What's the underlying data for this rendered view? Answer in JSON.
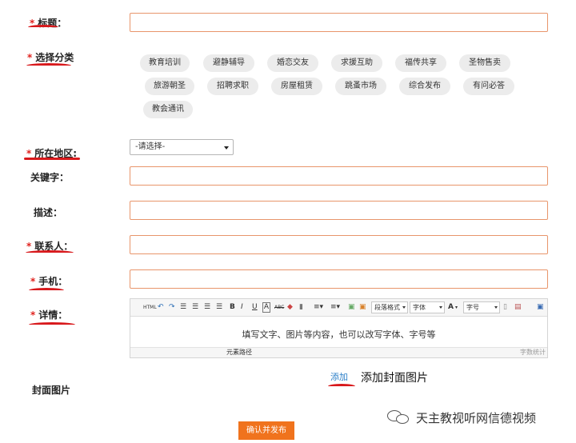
{
  "labels": {
    "required_mark": "*",
    "title": "标题：",
    "category": "选择分类",
    "region": "所在地区:",
    "keywords": "关键字：",
    "description": "描述：",
    "contact": "联系人：",
    "phone": "手机：",
    "details": "详情：",
    "cover": "封面图片"
  },
  "categories": [
    "教育培训",
    "避静辅导",
    "婚恋交友",
    "求援互助",
    "福传共享",
    "圣物售卖",
    "旅游朝圣",
    "招聘求职",
    "房屋租赁",
    "跳蚤市场",
    "综合发布",
    "有问必答",
    "教会通讯"
  ],
  "region_select": {
    "selected": "-请选择-"
  },
  "editor": {
    "toolbar": {
      "html": "HTML",
      "bold": "B",
      "italic": "I",
      "underline": "U",
      "font_color": "A",
      "strike": "ABC",
      "paragraph": "段落格式",
      "font": "字体",
      "font_size_icon": "A",
      "size": "字号"
    },
    "hint": "填写文字、图片等内容，也可以改写字体、字号等",
    "path_label": "元素路径",
    "count_label": "字数统计"
  },
  "cover": {
    "add_link": "添加",
    "add_note": "添加封面图片"
  },
  "submit_label": "确认并发布",
  "watermark": "天主教视听网信德视频",
  "colors": {
    "accent": "#f0731d",
    "required": "#e0231f",
    "input_border": "#e8956b",
    "link": "#2b7fc8"
  }
}
